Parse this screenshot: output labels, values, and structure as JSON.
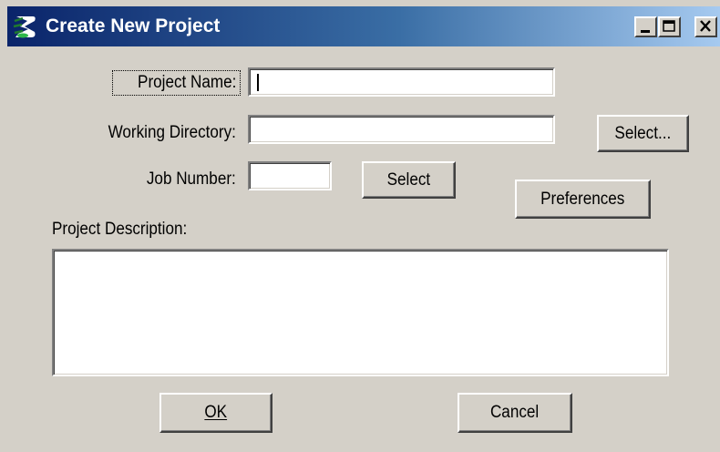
{
  "window": {
    "title": "Create New Project",
    "icon": "bentley-b-icon"
  },
  "fields": {
    "project_name": {
      "label": "Project Name:",
      "value": ""
    },
    "working_directory": {
      "label": "Working Directory:",
      "value": ""
    },
    "job_number": {
      "label": "Job Number:",
      "value": ""
    },
    "project_description": {
      "label": "Project Description:",
      "value": ""
    }
  },
  "buttons": {
    "select_directory": "Select...",
    "select_job": "Select",
    "preferences": "Preferences",
    "ok": "OK",
    "cancel": "Cancel"
  },
  "caption_buttons": [
    "minimize-icon",
    "maximize-icon",
    "close-icon"
  ]
}
